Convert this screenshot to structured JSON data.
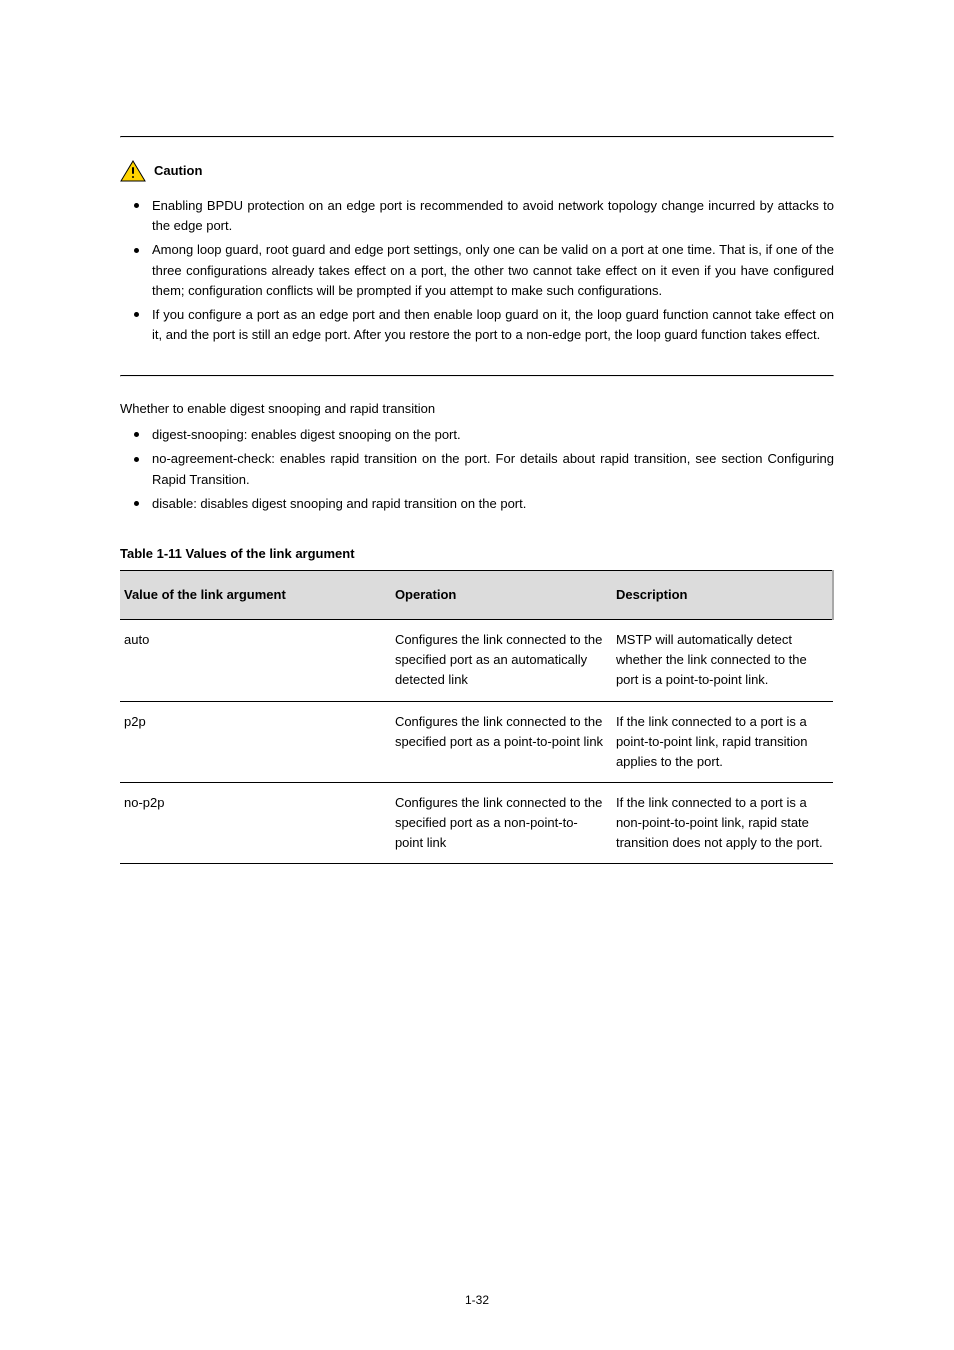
{
  "caution_label": "Caution",
  "caution_bullets": [
    "Enabling BPDU protection on an edge port is recommended to avoid network topology change incurred by attacks to the edge port.",
    "Among loop guard, root guard and edge port settings, only one can be valid on a port at one time. That is, if one of the three configurations already takes effect on a port, the other two cannot take effect on it even if you have configured them; configuration conflicts will be prompted if you attempt to make such configurations.",
    "If you configure a port as an edge port and then enable loop guard on it, the loop guard function cannot take effect on it, and the port is still an edge port. After you restore the port to a non-edge port, the loop guard function takes effect."
  ],
  "intro_text": "Whether to enable digest snooping and rapid transition",
  "feature_bullets": [
    "digest-snooping: enables digest snooping on the port.",
    "no-agreement-check: enables rapid transition on the port. For details about rapid transition, see section Configuring Rapid Transition.",
    "disable: disables digest snooping and rapid transition on the port."
  ],
  "table_caption": "Table 1-11 Values of the link argument",
  "table": {
    "headers": [
      "Value of the link argument",
      "Operation",
      "Description"
    ],
    "rows": [
      [
        "auto",
        "Configures the link connected to the specified port as an automatically detected link",
        "MSTP will automatically detect whether the link connected to the port is a point-to-point link."
      ],
      [
        "p2p",
        "Configures the link connected to the specified port as a point-to-point link",
        "If the link connected to a port is a point-to-point link, rapid transition applies to the port."
      ],
      [
        "no-p2p",
        "Configures the link connected to the specified port as a non-point-to-point link",
        "If the link connected to a port is a non-point-to-point link, rapid state transition does not apply to the port."
      ]
    ]
  },
  "page_number": "1-32"
}
